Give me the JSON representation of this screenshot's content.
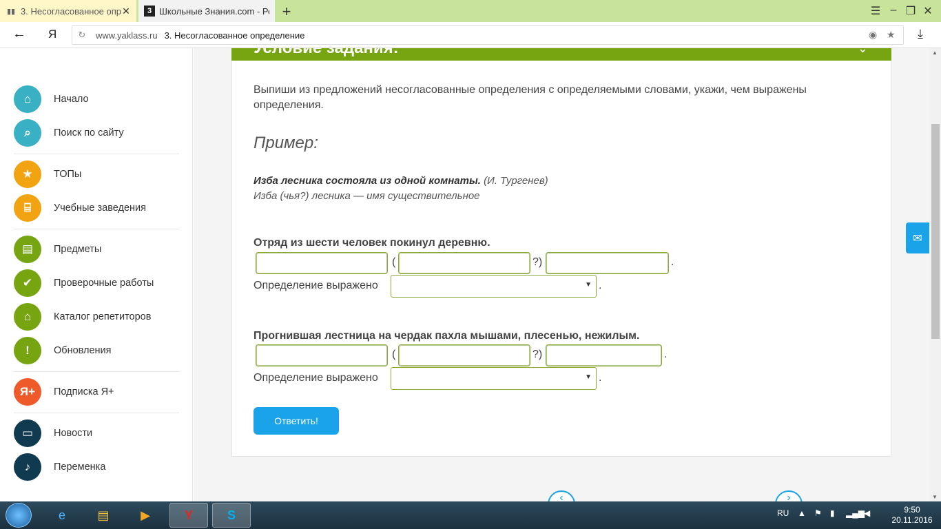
{
  "browser": {
    "tabs": [
      {
        "title": "3. Несогласованное опр",
        "active": true
      },
      {
        "title": "Школьные Знания.com - Ре",
        "active": false,
        "favicon": "3"
      }
    ],
    "url_host": "www.yaklass.ru",
    "url_title": "3. Несогласованное определение",
    "yandex_btn": "Я"
  },
  "sidebar": {
    "items": [
      {
        "label": "Начало",
        "icon": "home-icon"
      },
      {
        "label": "Поиск по сайту",
        "icon": "search-icon"
      },
      {
        "label": "ТОПы",
        "icon": "star-icon"
      },
      {
        "label": "Учебные заведения",
        "icon": "institution-icon"
      },
      {
        "label": "Предметы",
        "icon": "book-icon"
      },
      {
        "label": "Проверочные работы",
        "icon": "check-icon"
      },
      {
        "label": "Каталог репетиторов",
        "icon": "graduation-cap-icon"
      },
      {
        "label": "Обновления",
        "icon": "exclamation-icon"
      },
      {
        "label": "Подписка Я+",
        "icon": "ya-plus-icon",
        "glyph": "Я+"
      },
      {
        "label": "Новости",
        "icon": "chat-icon"
      },
      {
        "label": "Переменка",
        "icon": "bell-icon"
      }
    ]
  },
  "task": {
    "header": "Условие задания:",
    "instruction": "Выпиши из предложений несогласованные определения с определяемыми словами, укажи, чем выражены определения.",
    "example_heading": "Пример:",
    "example_sentence": "Изба лесника состояла из одной комнаты.",
    "example_author": "(И. Тургенев)",
    "example_answer": "Изба (чья?) лесника — имя существительное",
    "q1": "Отряд из шести человек покинул деревню.",
    "q2": "Прогнившая лестница на чердак пахла мышами, плесенью, нежилым.",
    "paren_open": "(",
    "paren_close": "?)",
    "period": ".",
    "defined_by_label": "Определение выражено",
    "select_value": "",
    "submit_label": "Ответить!"
  },
  "taskbar": {
    "lang": "RU",
    "time": "9:50",
    "date": "20.11.2016"
  },
  "colors": {
    "accent_green": "#76a511",
    "accent_blue": "#1aa3e8",
    "tabbar": "#c8e39a"
  }
}
